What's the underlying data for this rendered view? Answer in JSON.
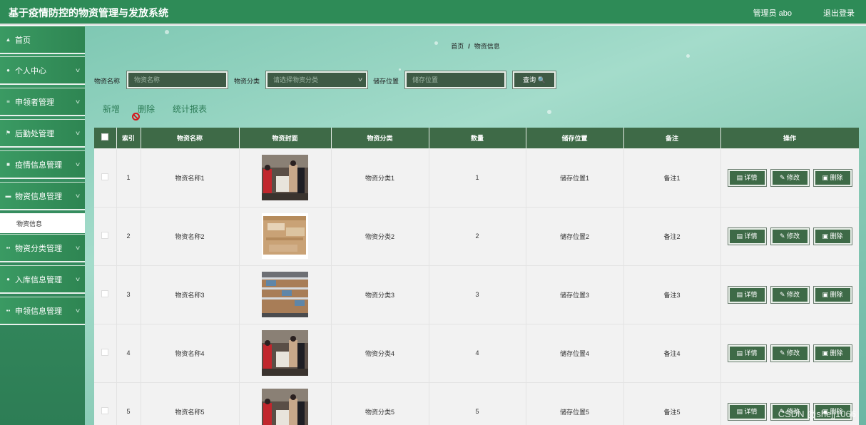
{
  "header": {
    "title": "基于疫情防控的物资管理与发放系统",
    "user": "管理员 abo",
    "logout": "退出登录"
  },
  "sidebar": {
    "items": [
      {
        "label": "首页",
        "icon": "home-icon"
      },
      {
        "label": "个人中心",
        "icon": "user-icon"
      },
      {
        "label": "申领者管理",
        "icon": "list-icon"
      },
      {
        "label": "后勤处管理",
        "icon": "flag-icon"
      },
      {
        "label": "疫情信息管理",
        "icon": "doc-icon"
      },
      {
        "label": "物资信息管理",
        "icon": "box-icon"
      },
      {
        "label": "物资分类管理",
        "icon": "grid-icon"
      },
      {
        "label": "入库信息管理",
        "icon": "user-icon"
      },
      {
        "label": "申领信息管理",
        "icon": "grid-icon"
      }
    ],
    "active_sub": "物资信息"
  },
  "breadcrumb": {
    "home": "首页",
    "sep": "/",
    "current": "物资信息"
  },
  "search": {
    "name_label": "物资名称",
    "name_placeholder": "物资名称",
    "category_label": "物资分类",
    "category_placeholder": "请选择物资分类",
    "location_label": "储存位置",
    "location_placeholder": "储存位置",
    "query_button": "查询 🔍"
  },
  "actions": {
    "add": "新增",
    "delete": "删除",
    "report": "统计报表"
  },
  "table": {
    "headers": [
      "索引",
      "物资名称",
      "物资封面",
      "物资分类",
      "数量",
      "储存位置",
      "备注",
      "操作"
    ],
    "rows": [
      {
        "index": "1",
        "name": "物资名称1",
        "category": "物资分类1",
        "qty": "1",
        "location": "储存位置1",
        "note": "备注1"
      },
      {
        "index": "2",
        "name": "物资名称2",
        "category": "物资分类2",
        "qty": "2",
        "location": "储存位置2",
        "note": "备注2"
      },
      {
        "index": "3",
        "name": "物资名称3",
        "category": "物资分类3",
        "qty": "3",
        "location": "储存位置3",
        "note": "备注3"
      },
      {
        "index": "4",
        "name": "物资名称4",
        "category": "物资分类4",
        "qty": "4",
        "location": "储存位置4",
        "note": "备注4"
      },
      {
        "index": "5",
        "name": "物资名称5",
        "category": "物资分类5",
        "qty": "5",
        "location": "储存位置5",
        "note": "备注5"
      }
    ],
    "op_detail": "详情",
    "op_edit": "修改",
    "op_delete": "删除"
  },
  "watermark": "CSDN @shejj1066",
  "colors": {
    "primary": "#2e8b57",
    "table_head": "#3e6a47",
    "input_bg": "#3e5a45"
  }
}
